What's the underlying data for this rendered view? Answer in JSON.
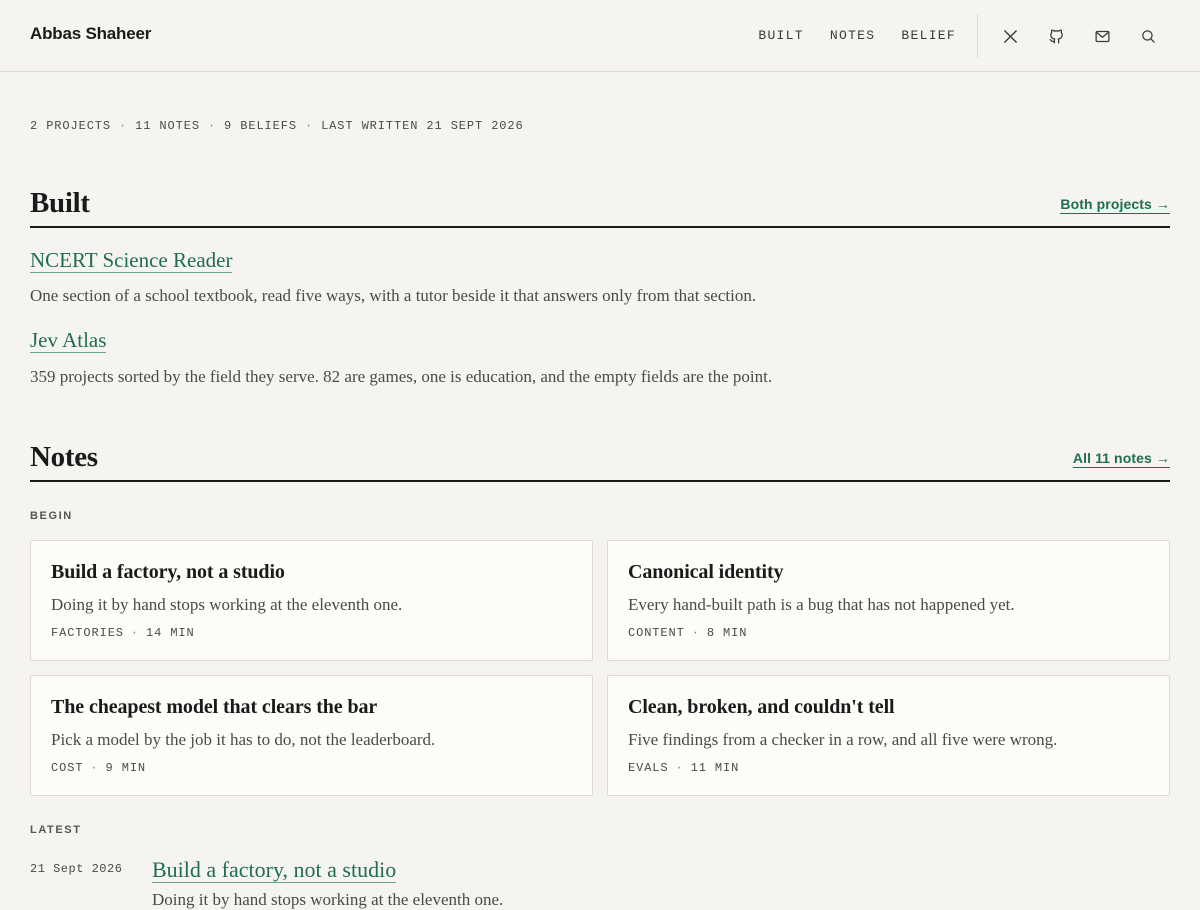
{
  "site": {
    "name": "Abbas Shaheer"
  },
  "nav": {
    "items": [
      {
        "label": "BUILT"
      },
      {
        "label": "NOTES"
      },
      {
        "label": "BELIEF"
      }
    ],
    "icons": [
      "x-icon",
      "github-icon",
      "mail-icon",
      "search-icon"
    ]
  },
  "stats": {
    "projects": "2 PROJECTS",
    "notes": "11 NOTES",
    "beliefs": "9 BELIEFS",
    "last_written": "LAST WRITTEN 21 SEPT 2026",
    "separator": "·"
  },
  "built": {
    "title": "Built",
    "link_label": "Both projects →",
    "projects": [
      {
        "title": "NCERT Science Reader",
        "description": "One section of a school textbook, read five ways, with a tutor beside it that answers only from that section."
      },
      {
        "title": "Jev Atlas",
        "description": "359 projects sorted by the field they serve. 82 are games, one is education, and the empty fields are the point."
      }
    ]
  },
  "notes": {
    "title": "Notes",
    "link_label": "All 11 notes →",
    "begin_label": "BEGIN",
    "cards": [
      {
        "title": "Build a factory, not a studio",
        "description": "Doing it by hand stops working at the eleventh one.",
        "tag": "FACTORIES",
        "read_time": "14 MIN"
      },
      {
        "title": "Canonical identity",
        "description": "Every hand-built path is a bug that has not happened yet.",
        "tag": "CONTENT",
        "read_time": "8 MIN"
      },
      {
        "title": "The cheapest model that clears the bar",
        "description": "Pick a model by the job it has to do, not the leaderboard.",
        "tag": "COST",
        "read_time": "9 MIN"
      },
      {
        "title": "Clean, broken, and couldn't tell",
        "description": "Five findings from a checker in a row, and all five were wrong.",
        "tag": "EVALS",
        "read_time": "11 MIN"
      }
    ],
    "latest_label": "LATEST",
    "latest": {
      "date": "21 Sept 2026",
      "title": "Build a factory, not a studio",
      "description": "Doing it by hand stops working at the eleventh one."
    }
  },
  "colors": {
    "background": "#f5f4f0",
    "accent": "#1f6e52",
    "text": "#1a1a1a",
    "muted": "#4a4a4a",
    "card": "#fdfcf8",
    "border": "#dcdad3"
  }
}
